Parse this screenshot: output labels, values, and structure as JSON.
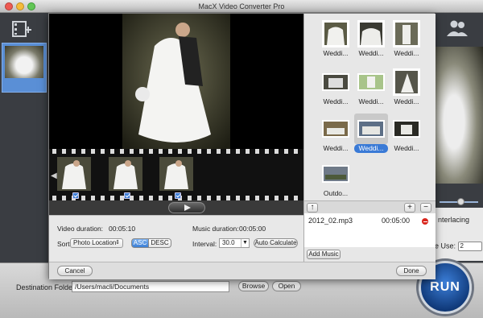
{
  "window": {
    "title": "MacX Video Converter Pro"
  },
  "background": {
    "deinterlacing_label": "nterlacing",
    "cpu_core_label": "e Use:",
    "cpu_core_value": "2",
    "destination_label": "Destination Folder:",
    "destination_path": "/Users/macli/Documents",
    "browse_label": "Browse",
    "open_label": "Open",
    "run_label": "RUN"
  },
  "dialog": {
    "video_duration_label": "Video duration:",
    "video_duration_value": "00:05:10",
    "music_duration_label": "Music duration:",
    "music_duration_value": "00:05:00",
    "sort_label": "Sort:",
    "sort_value": "Photo Location",
    "asc_label": "ASC",
    "desc_label": "DESC",
    "interval_label": "Interval:",
    "interval_value": "30.0",
    "auto_calc_label": "Auto Calculate",
    "cancel_label": "Cancel",
    "done_label": "Done",
    "add_music_label": "Add Music",
    "music": [
      {
        "file": "2012_02.mp3",
        "duration": "00:05:00"
      }
    ],
    "gallery": [
      {
        "label": "Weddi..."
      },
      {
        "label": "Weddi..."
      },
      {
        "label": "Weddi..."
      },
      {
        "label": "Weddi..."
      },
      {
        "label": "Weddi..."
      },
      {
        "label": "Weddi..."
      },
      {
        "label": "Weddi..."
      },
      {
        "label": "Weddi...",
        "selected": true
      },
      {
        "label": "Weddi..."
      },
      {
        "label": "Outdo..."
      }
    ]
  },
  "colors": {
    "accent": "#3a7ad6",
    "remove": "#d9251d"
  }
}
